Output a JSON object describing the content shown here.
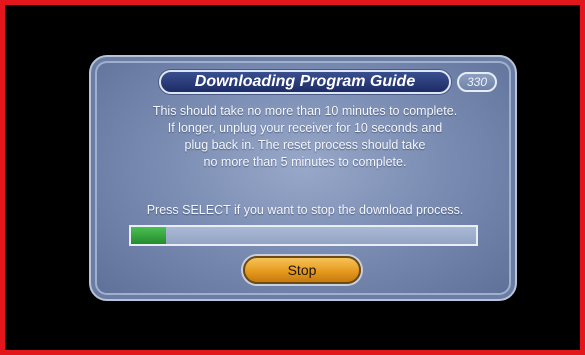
{
  "dialog": {
    "title": "Downloading Program Guide",
    "channel_number": "330",
    "message_lines": [
      "This should take no more than 10 minutes to complete.",
      "If longer, unplug your receiver for 10 seconds and",
      "plug back in.  The reset process should take",
      "no more than 5 minutes to complete."
    ],
    "instruction": "Press SELECT if you want to stop the download process.",
    "progress_fraction": 0.1,
    "stop_label": "Stop"
  },
  "colors": {
    "frame_border": "#e2161b",
    "progress_fill": "#2fa63a",
    "button": "#e69a1e",
    "title_pill": "#1d2c66"
  }
}
